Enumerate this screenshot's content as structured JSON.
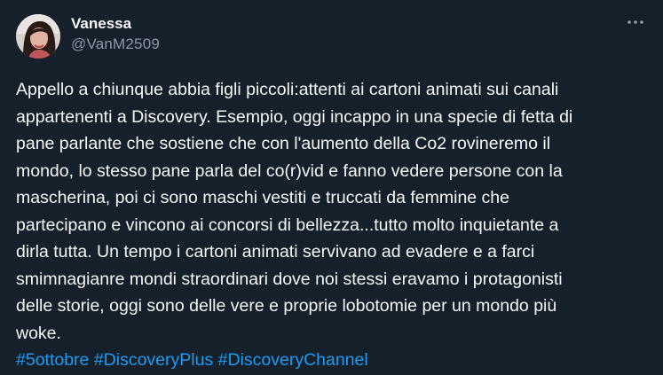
{
  "author": {
    "display_name": "Vanessa",
    "handle": "@VanM2509"
  },
  "menu": {
    "icon": "more-horizontal-icon"
  },
  "tweet": {
    "text": "Appello a chiunque abbia figli piccoli:attenti ai cartoni animati sui canali\nappartenenti a Discovery. Esempio, oggi incappo in una specie di fetta di\npane parlante che sostiene che con l'aumento della Co2 rovineremo il\nmondo, lo stesso pane parla del co(r)vid e fanno vedere persone con la\nmascherina, poi ci sono maschi vestiti e truccati da femmine che\npartecipano e vincono ai concorsi di bellezza...tutto molto inquietante a\ndirla tutta. Un tempo i cartoni animati servivano ad evadere e a farci\nsmimnagianre mondi straordinari dove noi stessi eravamo i protagonisti\ndelle storie, oggi sono delle vere e proprie lobotomie per un mondo più\nwoke.",
    "hashtags": [
      "#5ottobre",
      "#DiscoveryPlus",
      "#DiscoveryChannel"
    ]
  },
  "colors": {
    "background": "#15202b",
    "text": "#f7f9f9",
    "secondary": "#8b98a5",
    "link": "#1d9bf0"
  }
}
